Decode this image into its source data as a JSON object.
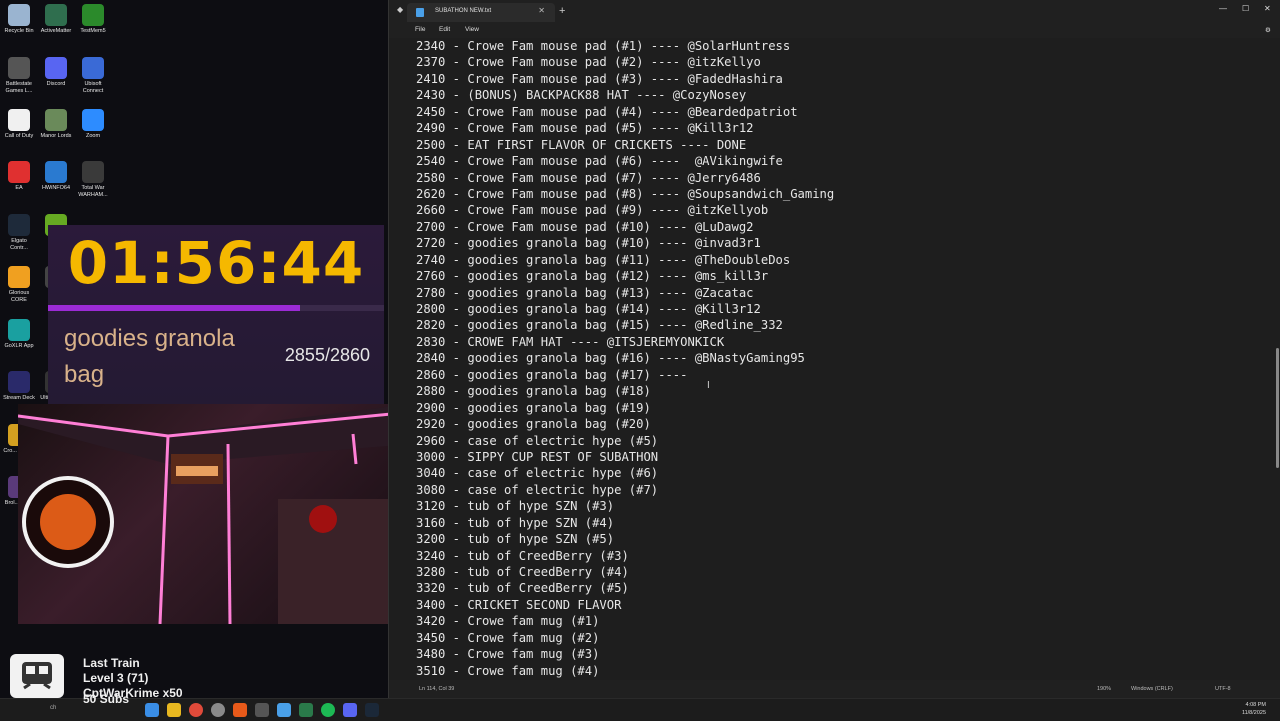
{
  "desktop": {
    "icons": [
      {
        "label": "Recycle Bin",
        "color": "#9ab4d0"
      },
      {
        "label": "ActiveMatter",
        "color": "#2f6e4e"
      },
      {
        "label": "TestMem5",
        "color": "#2b8a2b"
      },
      {
        "label": "Battlestate Games L...",
        "color": "#555555"
      },
      {
        "label": "Discord",
        "color": "#5865f2"
      },
      {
        "label": "Ubisoft Connect",
        "color": "#3a6ad6"
      },
      {
        "label": "Call of Duty",
        "color": "#f0f0f0"
      },
      {
        "label": "Manor Lords",
        "color": "#6a8a5a"
      },
      {
        "label": "Zoom",
        "color": "#2d8cff"
      },
      {
        "label": "EA",
        "color": "#e03030"
      },
      {
        "label": "HWiNFO64",
        "color": "#2a7ad0"
      },
      {
        "label": "Total War WARHAM...",
        "color": "#3a3a3a"
      },
      {
        "label": "Elgato Contr...",
        "color": "#1e2a3a"
      },
      {
        "label": "NVI...",
        "color": "#66aa22"
      },
      {
        "label": "Glorious CORE",
        "color": "#f0a020"
      },
      {
        "label": "OC...",
        "color": "#444444"
      },
      {
        "label": "GoXLR App",
        "color": "#1aa0a0"
      },
      {
        "label": "Stream Deck",
        "color": "#2a2a6a"
      },
      {
        "label": "Ultimate-W...",
        "color": "#333333"
      },
      {
        "label": "Battlefield™ 6",
        "color": "#333333"
      },
      {
        "label": "Cro... Cont...",
        "color": "#d4a020"
      },
      {
        "label": "Brol... Am...",
        "color": "#5a3a7a"
      }
    ]
  },
  "timer": {
    "time": "01:56:44",
    "progress_fraction": 0.75,
    "goal_label": "goodies granola bag",
    "goal_count": "2855/2860"
  },
  "train": {
    "title": "Last Train",
    "level": "Level 3  (71)",
    "user": "CptWarKrime x50",
    "subs": "50 Subs"
  },
  "notepad": {
    "tab_title": "SUBATHON NEW.txt",
    "menu": [
      "File",
      "Edit",
      "View"
    ],
    "lines": [
      "2340 - Crowe Fam mouse pad (#1) ---- @SolarHuntress",
      "2370 - Crowe Fam mouse pad (#2) ---- @itzKellyo",
      "2410 - Crowe Fam mouse pad (#3) ---- @FadedHashira",
      "2430 - (BONUS) BACKPACK88 HAT ---- @CozyNosey",
      "2450 - Crowe Fam mouse pad (#4) ---- @Beardedpatriot",
      "2490 - Crowe Fam mouse pad (#5) ---- @Kill3r12",
      "2500 - EAT FIRST FLAVOR OF CRICKETS ---- DONE",
      "2540 - Crowe Fam mouse pad (#6) ----  @AVikingwife",
      "2580 - Crowe Fam mouse pad (#7) ---- @Jerry6486",
      "2620 - Crowe Fam mouse pad (#8) ---- @Soupsandwich_Gaming",
      "2660 - Crowe Fam mouse pad (#9) ---- @itzKellyob",
      "2700 - Crowe Fam mouse pad (#10) ---- @LuDawg2",
      "2720 - goodies granola bag (#10) ---- @invad3r1",
      "2740 - goodies granola bag (#11) ---- @TheDoubleDos",
      "2760 - goodies granola bag (#12) ---- @ms_kill3r",
      "2780 - goodies granola bag (#13) ---- @Zacatac",
      "2800 - goodies granola bag (#14) ---- @Kill3r12",
      "2820 - goodies granola bag (#15) ---- @Redline_332",
      "2830 - CROWE FAM HAT ---- @ITSJEREMYONKICK",
      "2840 - goodies granola bag (#16) ---- @BNastyGaming95",
      "2860 - goodies granola bag (#17) ----",
      "2880 - goodies granola bag (#18)",
      "2900 - goodies granola bag (#19)",
      "2920 - goodies granola bag (#20)",
      "2960 - case of electric hype (#5)",
      "3000 - SIPPY CUP REST OF SUBATHON",
      "3040 - case of electric hype (#6)",
      "3080 - case of electric hype (#7)",
      "3120 - tub of hype SZN (#3)",
      "3160 - tub of hype SZN (#4)",
      "3200 - tub of hype SZN (#5)",
      "3240 - tub of CreedBerry (#3)",
      "3280 - tub of CreedBerry (#4)",
      "3320 - tub of CreedBerry (#5)",
      "3400 - CRICKET SECOND FLAVOR",
      "3420 - Crowe fam mug (#1)",
      "3450 - Crowe fam mug (#2)",
      "3480 - Crowe fam mug (#3)",
      "3510 - Crowe fam mug (#4)"
    ],
    "status": {
      "position": "Ln 114, Col 39",
      "zoom": "190%",
      "line_ending": "Windows (CRLF)",
      "encoding": "UTF-8"
    }
  },
  "taskbar": {
    "search_placeholder": "ch",
    "time": "4:08 PM",
    "date": "11/8/2025"
  }
}
